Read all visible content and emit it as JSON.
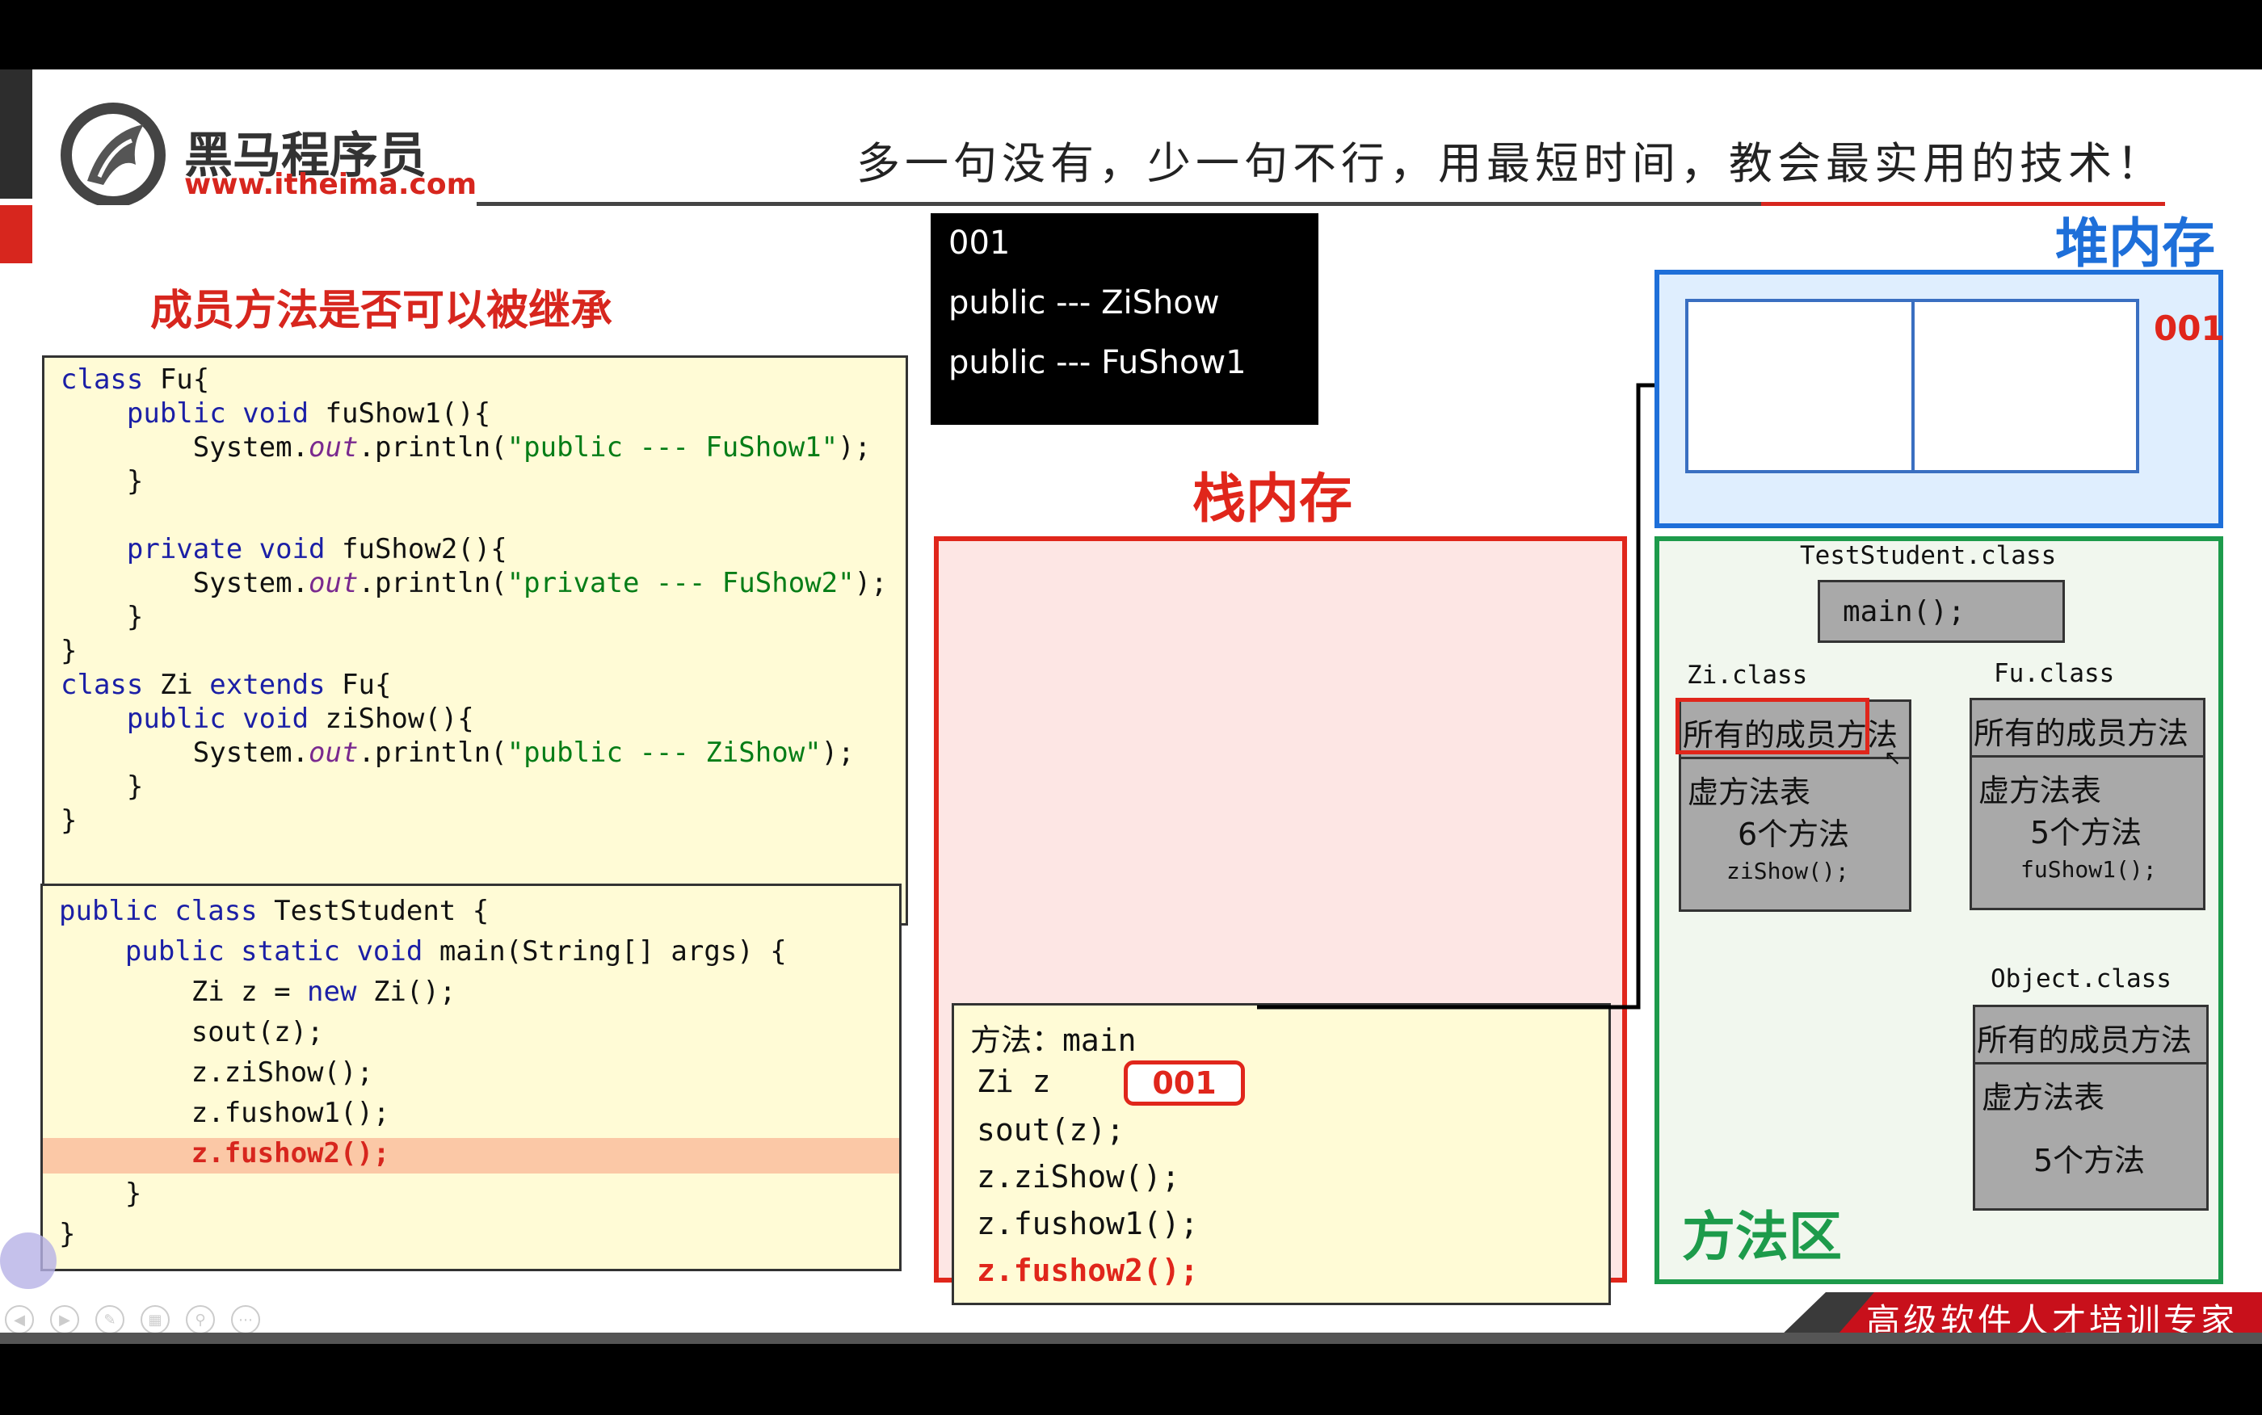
{
  "header": {
    "logo_cn": "黑马程序员",
    "logo_url": "www.itheima.com",
    "slogan": "多一句没有，少一句不行，用最短时间，教会最实用的技术！"
  },
  "slide_title": "成员方法是否可以被继承",
  "code_fu": [
    "class Fu{",
    "    public void fuShow1(){",
    "        System.out.println(\"public --- FuShow1\");",
    "    }",
    "",
    "    private void fuShow2(){",
    "        System.out.println(\"private --- FuShow2\");",
    "    }",
    "}",
    "class Zi extends Fu{",
    "    public void ziShow(){",
    "        System.out.println(\"public --- ZiShow\");",
    "    }",
    "}"
  ],
  "code_test": [
    "public class TestStudent {",
    "    public static void main(String[] args) {",
    "        Zi z = new Zi();",
    "        sout(z);",
    "        z.ziShow();",
    "        z.fushow1();",
    "        z.fushow2();",
    "    }",
    "}"
  ],
  "console": {
    "lines": [
      "001",
      "public --- ZiShow",
      "public --- FuShow1"
    ]
  },
  "stack": {
    "title": "栈内存",
    "frame_title": "方法：main",
    "var_label": "Zi z",
    "var_value": "001",
    "lines": [
      "sout(z);",
      "z.ziShow();",
      "z.fushow1();",
      "z.fushow2();"
    ]
  },
  "heap": {
    "title": "堆内存",
    "address": "001"
  },
  "method_area": {
    "title": "方法区",
    "test_class": "TestStudent.class",
    "main_method": "main();",
    "zi": {
      "label": "Zi.class",
      "members": "所有的成员方法",
      "vtable": "虚方法表",
      "count": "6个方法",
      "method": "ziShow();"
    },
    "fu": {
      "label": "Fu.class",
      "members": "所有的成员方法",
      "vtable": "虚方法表",
      "count": "5个方法",
      "method": "fuShow1();"
    },
    "object": {
      "label": "Object.class",
      "members": "所有的成员方法",
      "vtable": "虚方法表",
      "count": "5个方法"
    }
  },
  "footer": {
    "tagline": "高级软件人才培训专家"
  },
  "colors": {
    "accent_red": "#e0261b",
    "heap_blue": "#1e6fd9",
    "method_green": "#1d9b4b"
  }
}
